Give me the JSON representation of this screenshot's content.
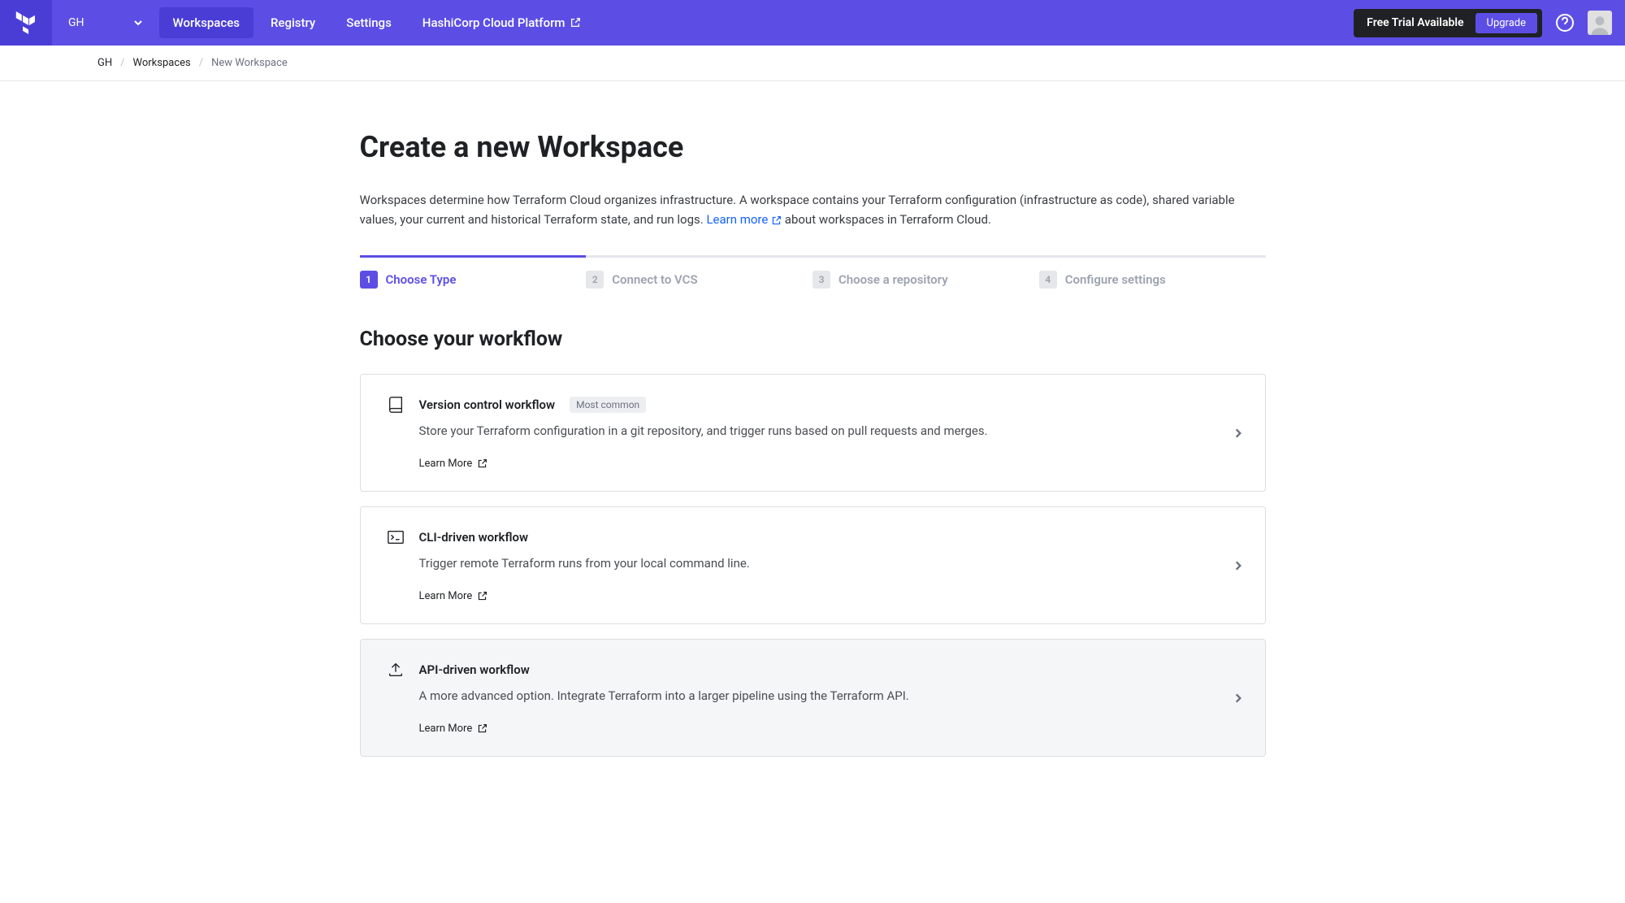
{
  "nav": {
    "org": "GH",
    "links": {
      "workspaces": "Workspaces",
      "registry": "Registry",
      "settings": "Settings",
      "hcp": "HashiCorp Cloud Platform"
    },
    "trial": "Free Trial Available",
    "upgrade": "Upgrade"
  },
  "breadcrumb": {
    "org": "GH",
    "workspaces": "Workspaces",
    "current": "New Workspace"
  },
  "page": {
    "title": "Create a new Workspace",
    "desc_part1": "Workspaces determine how Terraform Cloud organizes infrastructure. A workspace contains your Terraform configuration (infrastructure as code), shared variable values, your current and historical Terraform state, and run logs. ",
    "learn_more_link": "Learn more",
    "desc_part2": " about workspaces in Terraform Cloud."
  },
  "steps": [
    {
      "num": "1",
      "label": "Choose Type"
    },
    {
      "num": "2",
      "label": "Connect to VCS"
    },
    {
      "num": "3",
      "label": "Choose a repository"
    },
    {
      "num": "4",
      "label": "Configure settings"
    }
  ],
  "section_title": "Choose your workflow",
  "workflows": [
    {
      "title": "Version control workflow",
      "badge": "Most common",
      "desc": "Store your Terraform configuration in a git repository, and trigger runs based on pull requests and merges.",
      "learn": "Learn More"
    },
    {
      "title": "CLI-driven workflow",
      "desc": "Trigger remote Terraform runs from your local command line.",
      "learn": "Learn More"
    },
    {
      "title": "API-driven workflow",
      "desc": "A more advanced option. Integrate Terraform into a larger pipeline using the Terraform API.",
      "learn": "Learn More"
    }
  ]
}
